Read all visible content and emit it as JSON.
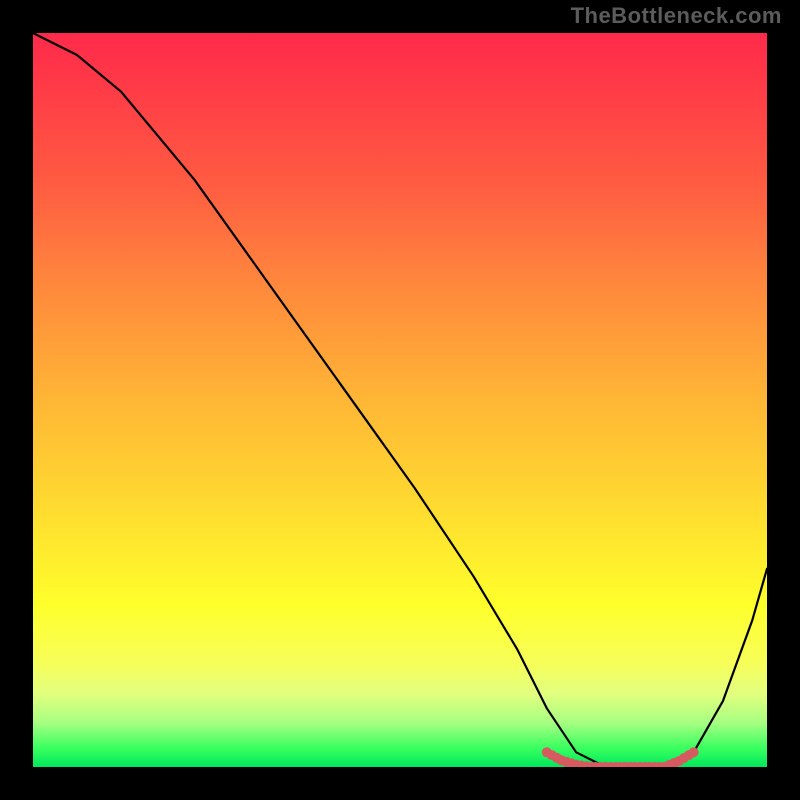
{
  "watermark": "TheBottleneck.com",
  "chart_data": {
    "type": "line",
    "title": "",
    "xlabel": "",
    "ylabel": "",
    "xlim": [
      0,
      100
    ],
    "ylim": [
      0,
      100
    ],
    "series": [
      {
        "name": "bottleneck-curve",
        "x": [
          0,
          6,
          12,
          22,
          32,
          42,
          52,
          60,
          66,
          70,
          74,
          78,
          82,
          86,
          90,
          94,
          98,
          100
        ],
        "y": [
          100,
          97,
          92,
          80,
          66,
          52,
          38,
          26,
          16,
          8,
          2,
          0,
          0,
          0,
          2,
          9,
          20,
          27
        ],
        "color": "#000000"
      },
      {
        "name": "optimal-range-marker",
        "x": [
          70,
          72,
          74,
          76,
          78,
          80,
          82,
          84,
          86,
          88,
          90
        ],
        "y": [
          2,
          0.9,
          0.3,
          0,
          0,
          0,
          0,
          0,
          0,
          0.8,
          2
        ],
        "color": "#d65a5f",
        "style": "dotted-thick"
      }
    ],
    "gradient_stops": [
      {
        "pos": 0,
        "color": "#ff2a4b"
      },
      {
        "pos": 0.2,
        "color": "#ff5a42"
      },
      {
        "pos": 0.5,
        "color": "#ffb636"
      },
      {
        "pos": 0.78,
        "color": "#ffff2b"
      },
      {
        "pos": 0.94,
        "color": "#a6ff82"
      },
      {
        "pos": 1.0,
        "color": "#00e85c"
      }
    ]
  }
}
